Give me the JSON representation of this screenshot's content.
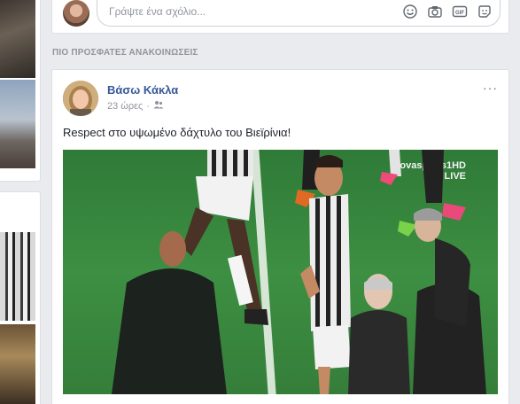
{
  "comment_box": {
    "placeholder": "Γράψτε ένα σχόλιο...",
    "icons": [
      "emoji-icon",
      "camera-icon",
      "gif-icon",
      "sticker-icon"
    ]
  },
  "section_header": "ΠΙΟ ΠΡΟΣΦΑΤΕΣ ΑΝΑΚΟΙΝΩΣΕΙΣ",
  "post": {
    "author": "Βάσω Κάκλα",
    "time": "23 ώρες",
    "separator": "·",
    "audience_icon": "friends-icon",
    "more": "···",
    "text": "Respect στο υψωμένο δάχτυλο του Βιεϊρίνια!",
    "image_watermark_line1": "ovasports1HD",
    "image_watermark_line2": "LIVE"
  },
  "colors": {
    "page_bg": "#e9ebee",
    "link": "#365899",
    "muted": "#90949c",
    "text": "#1d2129"
  }
}
